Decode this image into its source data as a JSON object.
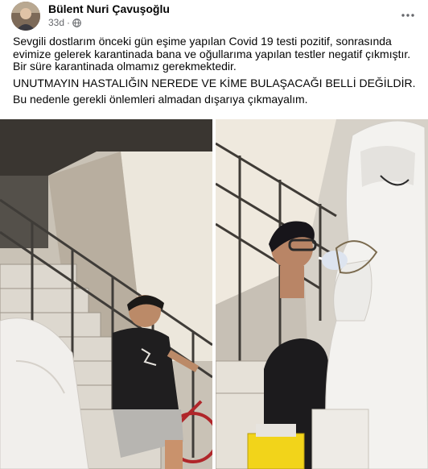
{
  "post": {
    "author": "Bülent Nuri Çavuşoğlu",
    "time": "33d",
    "privacy_icon": "globe-icon",
    "more_icon": "more-options-icon",
    "paragraphs": [
      "Sevgili dostlarım önceki gün eşime yapılan Covid 19 testi pozitif, sonrasında evimize gelerek karantinada bana ve oğullarıma yapılan testler negatif çıkmıştır. Bir süre karantinada olmamız gerekmektedir.",
      "UNUTMAYIN HASTALIĞIN NEREDE VE KİME BULAŞACAĞI BELLİ DEĞİLDİR.",
      "Bu nedenle gerekli önlemleri almadan dışarıya çıkmayalım."
    ],
    "photos": [
      {
        "subject": "boy-sitting-on-stairs"
      },
      {
        "subject": "health-worker-taking-swab"
      }
    ]
  },
  "colors": {
    "text": "#050505",
    "meta": "#65676b",
    "background": "#ffffff"
  }
}
